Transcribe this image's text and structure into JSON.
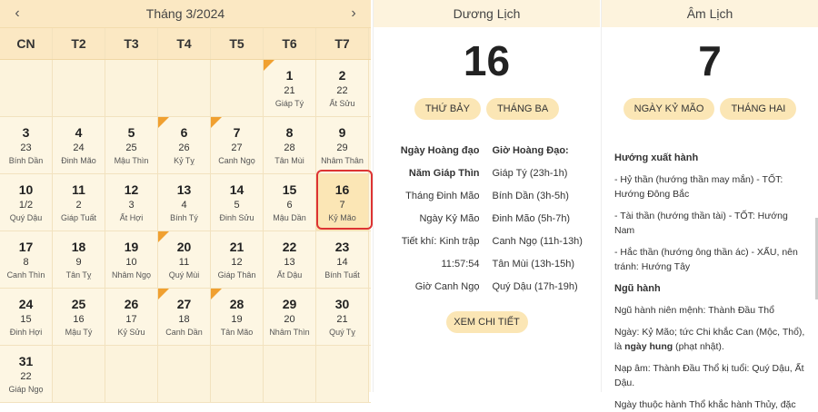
{
  "calendar": {
    "title": "Tháng 3/2024",
    "prev": "‹",
    "next": "›",
    "weekdays": [
      "CN",
      "T2",
      "T3",
      "T4",
      "T5",
      "T6",
      "T7"
    ],
    "rows": [
      [
        null,
        null,
        null,
        null,
        null,
        {
          "d": "1",
          "l": "21",
          "c": "Giáp Tý",
          "mark": true
        },
        {
          "d": "2",
          "l": "22",
          "c": "Ất Sửu"
        }
      ],
      [
        {
          "d": "3",
          "l": "23",
          "c": "Bính Dần"
        },
        {
          "d": "4",
          "l": "24",
          "c": "Đinh Mão"
        },
        {
          "d": "5",
          "l": "25",
          "c": "Mậu Thìn"
        },
        {
          "d": "6",
          "l": "26",
          "c": "Kỷ Tỵ",
          "mark": true
        },
        {
          "d": "7",
          "l": "27",
          "c": "Canh Ngọ",
          "mark": true
        },
        {
          "d": "8",
          "l": "28",
          "c": "Tân Mùi"
        },
        {
          "d": "9",
          "l": "29",
          "c": "Nhâm Thân"
        }
      ],
      [
        {
          "d": "10",
          "l": "1/2",
          "c": "Quý Dậu"
        },
        {
          "d": "11",
          "l": "2",
          "c": "Giáp Tuất"
        },
        {
          "d": "12",
          "l": "3",
          "c": "Ất Hợi"
        },
        {
          "d": "13",
          "l": "4",
          "c": "Bính Tý"
        },
        {
          "d": "14",
          "l": "5",
          "c": "Đinh Sửu"
        },
        {
          "d": "15",
          "l": "6",
          "c": "Mậu Dần"
        },
        {
          "d": "16",
          "l": "7",
          "c": "Kỷ Mão",
          "sel": true
        }
      ],
      [
        {
          "d": "17",
          "l": "8",
          "c": "Canh Thìn"
        },
        {
          "d": "18",
          "l": "9",
          "c": "Tân Tỵ"
        },
        {
          "d": "19",
          "l": "10",
          "c": "Nhâm Ngọ"
        },
        {
          "d": "20",
          "l": "11",
          "c": "Quý Mùi",
          "mark": true
        },
        {
          "d": "21",
          "l": "12",
          "c": "Giáp Thân"
        },
        {
          "d": "22",
          "l": "13",
          "c": "Ất Dậu"
        },
        {
          "d": "23",
          "l": "14",
          "c": "Bính Tuất"
        }
      ],
      [
        {
          "d": "24",
          "l": "15",
          "c": "Đinh Hợi"
        },
        {
          "d": "25",
          "l": "16",
          "c": "Mậu Tý"
        },
        {
          "d": "26",
          "l": "17",
          "c": "Kỷ Sửu"
        },
        {
          "d": "27",
          "l": "18",
          "c": "Canh Dần",
          "mark": true
        },
        {
          "d": "28",
          "l": "19",
          "c": "Tân Mão",
          "mark": true
        },
        {
          "d": "29",
          "l": "20",
          "c": "Nhâm Thìn"
        },
        {
          "d": "30",
          "l": "21",
          "c": "Quý Tỵ"
        }
      ],
      [
        {
          "d": "31",
          "l": "22",
          "c": "Giáp Ngọ"
        },
        null,
        null,
        null,
        null,
        null,
        null
      ]
    ]
  },
  "duong": {
    "header": "Dương Lịch",
    "day": "16",
    "weekday": "THỨ BẢY",
    "month": "THÁNG BA",
    "left": [
      "Ngày Hoàng đạo",
      "Năm Giáp Thìn",
      "Tháng Đinh Mão",
      "Ngày Kỷ Mão",
      "Tiết khí: Kinh trập",
      "11:57:54",
      "Giờ Canh Ngọ"
    ],
    "right_title": "Giờ Hoàng Đạo:",
    "right": [
      "Giáp Tý (23h-1h)",
      "Bính Dần (3h-5h)",
      "Đinh Mão (5h-7h)",
      "Canh Ngọ (11h-13h)",
      "Tân Mùi (13h-15h)",
      "Quý Dậu (17h-19h)"
    ],
    "button": "XEM CHI TIẾT"
  },
  "am": {
    "header": "Âm Lịch",
    "day": "7",
    "day_name": "NGÀY KỶ MÃO",
    "month": "THÁNG HAI",
    "h1": "Hướng xuất hành",
    "p1": "- Hỷ thần (hướng thần may mắn) - TỐT: Hướng Đông Bắc",
    "p2": "- Tài thần (hướng thần tài) - TỐT: Hướng Nam",
    "p3": "- Hắc thần (hướng ông thần ác) - XẤU, nên tránh: Hướng Tây",
    "h2": "Ngũ hành",
    "p4": "Ngũ hành niên mệnh: Thành Đầu Thổ",
    "p5a": "Ngày: Kỷ Mão; tức Chi khắc Can (Mộc, Thổ), là ",
    "p5b": "ngày hung",
    "p5c": " (phạt nhật).",
    "p6": "Nạp âm: Thành Đầu Thổ kị tuổi: Quý Dậu, Ất Dậu.",
    "p7": "Ngày thuộc hành Thổ khắc hành Thủy, đặc"
  },
  "colors": {
    "accent": "#fbe6b5",
    "mark": "#f0a030",
    "select": "#d33"
  }
}
